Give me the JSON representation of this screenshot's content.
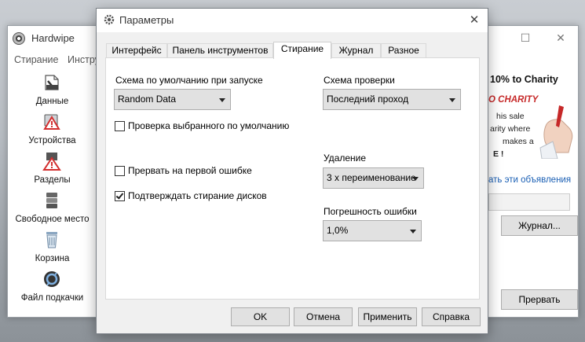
{
  "background_window": {
    "title": "Hardwipe",
    "maximize_glyph": "☐",
    "close_glyph": "✕",
    "menu": [
      "Стирание",
      "Инстру"
    ],
    "sidebar": [
      {
        "label": "Данные",
        "icon": "data-file-icon"
      },
      {
        "label": "Устройства",
        "icon": "devices-warning-icon"
      },
      {
        "label": "Разделы",
        "icon": "partitions-icon"
      },
      {
        "label": "Свободное место",
        "icon": "free-space-icon"
      },
      {
        "label": "Корзина",
        "icon": "recycle-bin-icon"
      },
      {
        "label": "Файл подкачки",
        "icon": "swap-file-icon"
      }
    ],
    "ad": {
      "headline": "10% to Charity",
      "stamp": "O CHARITY",
      "lines": [
        "his sale",
        "arity where",
        "makes a",
        "E !"
      ]
    },
    "ads_link": "ать эти объявления",
    "journal_button": "Журнал...",
    "stop_button": "Прервать"
  },
  "dialog": {
    "title": "Параметры",
    "close_glyph": "✕",
    "tabs": [
      "Интерфейс",
      "Панель инструментов",
      "Стирание",
      "Журнал",
      "Разное"
    ],
    "active_tab": "Стирание",
    "default_scheme": {
      "label": "Схема по умолчанию при запуске",
      "value": "Random Data"
    },
    "check_scheme": {
      "label": "Схема проверки",
      "value": "Последний проход"
    },
    "checkboxes": [
      {
        "label": "Проверка выбранного по умолчанию",
        "checked": false
      },
      {
        "label": "Прервать на первой ошибке",
        "checked": false
      },
      {
        "label": "Подтверждать стирание дисков",
        "checked": true
      }
    ],
    "deletion": {
      "label": "Удаление",
      "value": "3 x переименование"
    },
    "error_margin": {
      "label": "Погрешность ошибки",
      "value": "1,0%"
    },
    "buttons": {
      "ok": "OK",
      "cancel": "Отмена",
      "apply": "Применить",
      "help": "Справка"
    }
  },
  "colors": {
    "link": "#1a5fb4",
    "stamp": "#c62828",
    "warning": "#d32f2f"
  }
}
